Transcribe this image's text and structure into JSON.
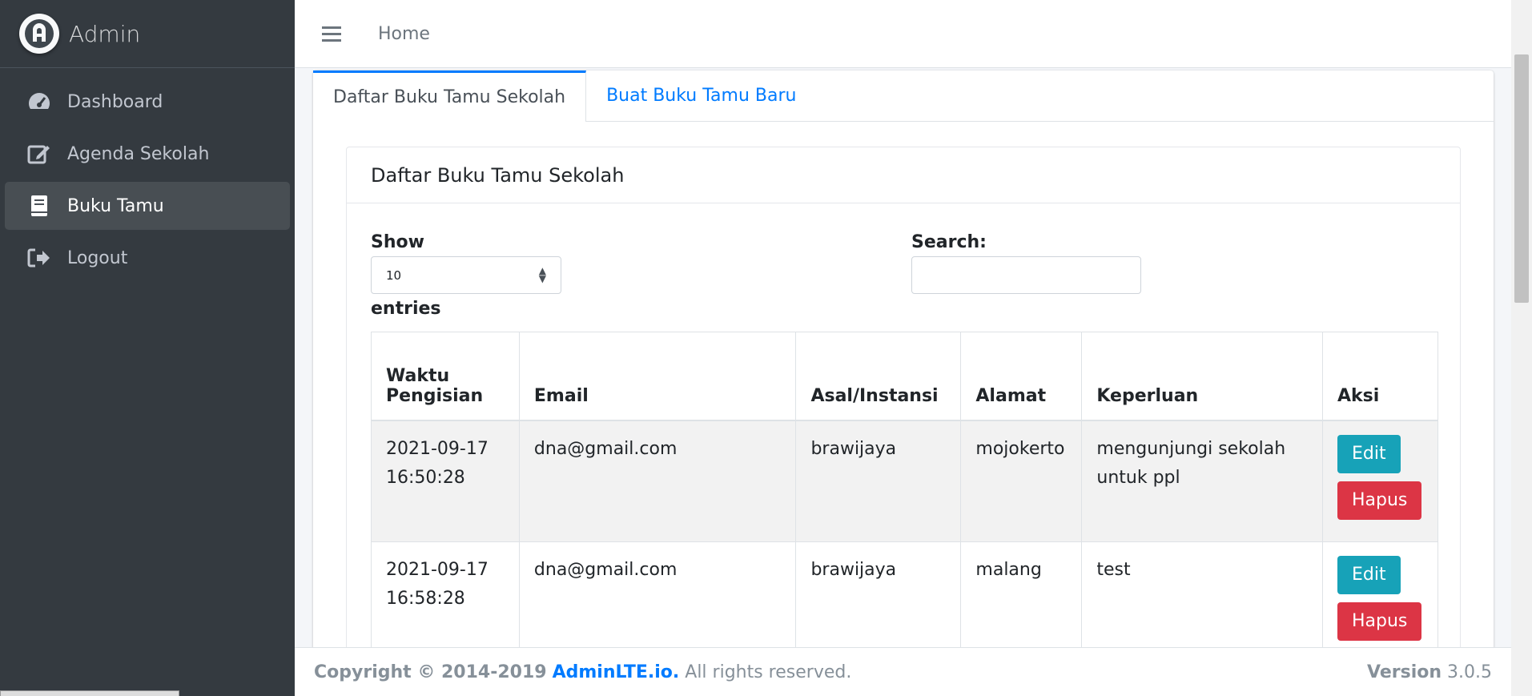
{
  "brand": {
    "name": "Admin"
  },
  "sidebar": {
    "items": [
      {
        "label": "Dashboard",
        "icon": "tachometer-icon"
      },
      {
        "label": "Agenda Sekolah",
        "icon": "edit-icon"
      },
      {
        "label": "Buku Tamu",
        "icon": "book-icon",
        "active": true
      },
      {
        "label": "Logout",
        "icon": "sign-out-icon"
      }
    ]
  },
  "navbar": {
    "home": "Home"
  },
  "tabs": [
    {
      "label": "Daftar Buku Tamu Sekolah",
      "active": true
    },
    {
      "label": "Buat Buku Tamu Baru"
    }
  ],
  "card": {
    "title": "Daftar Buku Tamu Sekolah"
  },
  "controls": {
    "show_label": "Show",
    "entries_value": "10",
    "entries_label": "entries",
    "search_label": "Search:",
    "search_value": ""
  },
  "table": {
    "headers": [
      "Waktu Pengisian",
      "Email",
      "Asal/Instansi",
      "Alamat",
      "Keperluan",
      "Aksi"
    ],
    "rows": [
      {
        "waktu": "2021-09-17 16:50:28",
        "email": "dna@gmail.com",
        "asal": "brawijaya",
        "alamat": "mojokerto",
        "keperluan": "mengunjungi sekolah untuk ppl"
      },
      {
        "waktu": "2021-09-17 16:58:28",
        "email": "dna@gmail.com",
        "asal": "brawijaya",
        "alamat": "malang",
        "keperluan": "test"
      }
    ],
    "edit_label": "Edit",
    "delete_label": "Hapus"
  },
  "footer": {
    "copyright": "Copyright © 2014-2019",
    "link": "AdminLTE.io.",
    "rights": "All rights reserved.",
    "version_label": "Version",
    "version": "3.0.5"
  },
  "colors": {
    "sidebar_bg": "#343a40",
    "primary": "#007bff",
    "edit_button": "#17a2b8",
    "delete_button": "#dc3545"
  }
}
